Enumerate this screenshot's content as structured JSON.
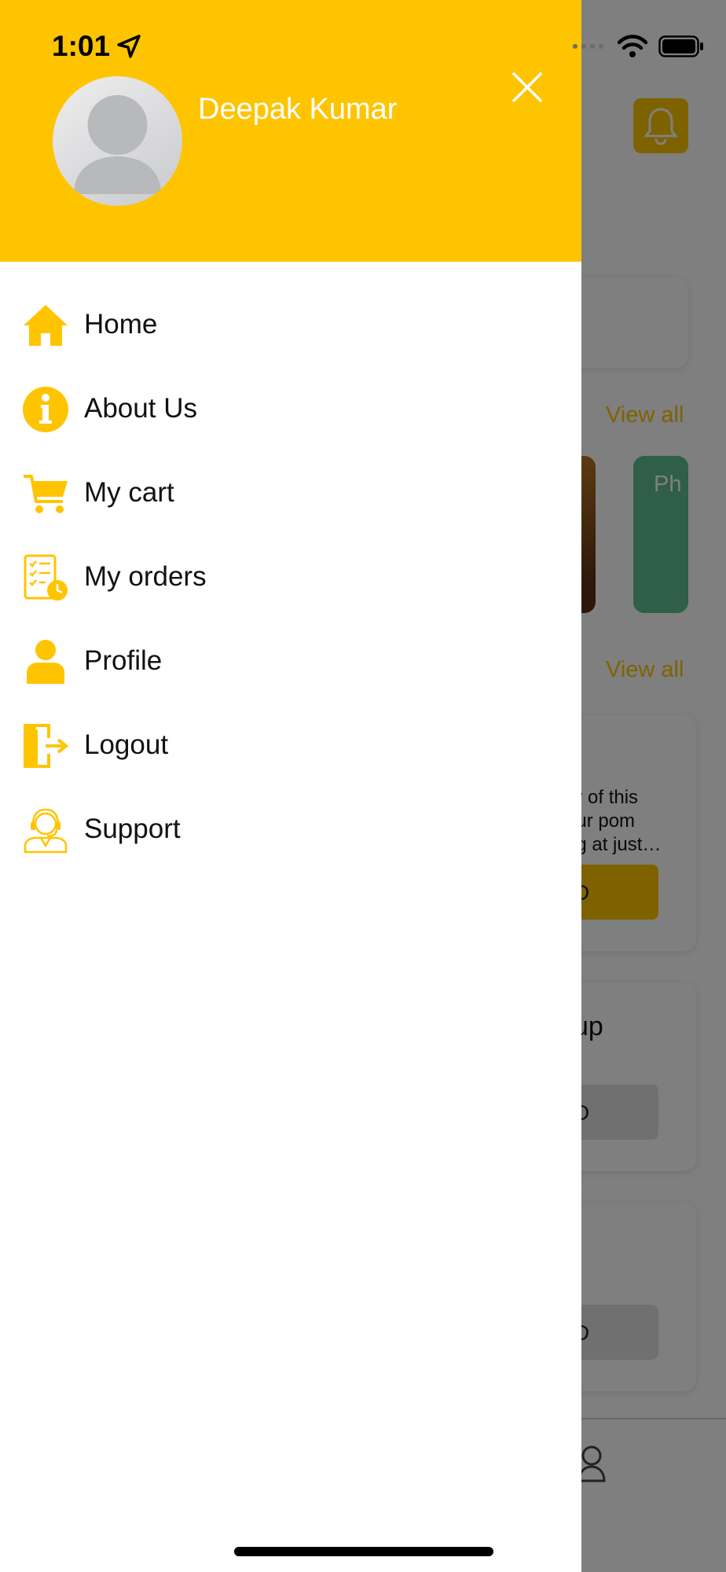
{
  "status_bar": {
    "time": "1:01"
  },
  "background": {
    "view_all_1": "View all",
    "view_all_2": "View all",
    "category_partial": "Ph",
    "offer_lines": [
      "or of this",
      "our pom",
      "ng at just…"
    ],
    "card_title_partial": "up",
    "button_partial": "D"
  },
  "drawer": {
    "user_name": "Deepak Kumar",
    "menu": [
      {
        "label": "Home",
        "icon": "home-icon"
      },
      {
        "label": "About Us",
        "icon": "info-icon"
      },
      {
        "label": "My cart",
        "icon": "cart-icon"
      },
      {
        "label": "My orders",
        "icon": "orders-icon"
      },
      {
        "label": "Profile",
        "icon": "profile-icon"
      },
      {
        "label": "Logout",
        "icon": "logout-icon"
      },
      {
        "label": "Support",
        "icon": "support-icon"
      }
    ]
  },
  "colors": {
    "accent": "#FFC400",
    "overlay": "rgba(0,0,0,0.5)"
  }
}
